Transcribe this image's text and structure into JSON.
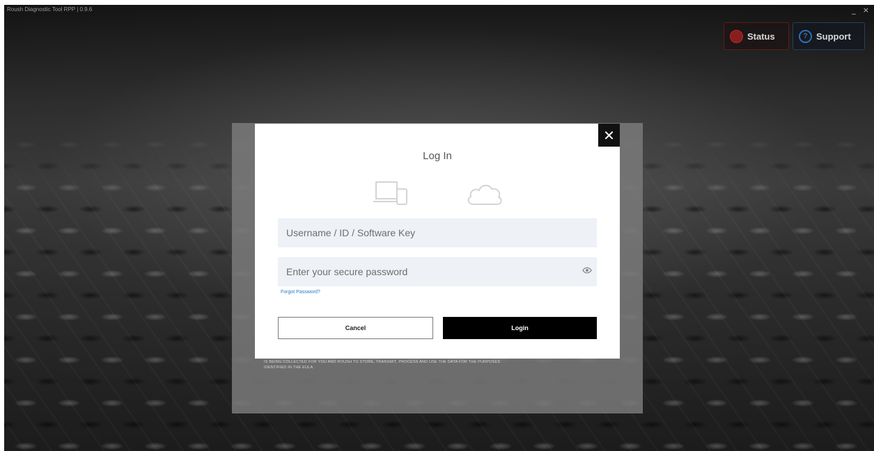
{
  "window": {
    "title": "Roush Diagnostic Tool RPP | 0.9.6",
    "minimize_glyph": "_",
    "close_glyph": "×"
  },
  "header": {
    "status_label": "Status",
    "support_label": "Support",
    "status_icon": "status-indicator-icon",
    "support_icon": "help-circle-icon",
    "status_color": "#8a1d1d",
    "support_color": "#2f6fb8"
  },
  "dialog": {
    "title": "Log In",
    "close_glyph": "✕",
    "mode_icons": [
      "device-icon",
      "cloud-icon"
    ],
    "username": {
      "placeholder": "Username / ID / Software Key",
      "value": ""
    },
    "password": {
      "placeholder": "Enter your secure password",
      "value": ""
    },
    "forgot_label": "Forgot Password?",
    "cancel_label": "Cancel",
    "login_label": "Login"
  },
  "backdrop": {
    "disclaimer": "IS BEING COLLECTED FOR YOU AND ROUSH TO STORE, TRANSMIT, PROCESS AND USE THE DATA FOR THE PURPOSES IDENTIFIED IN THE EULA."
  }
}
